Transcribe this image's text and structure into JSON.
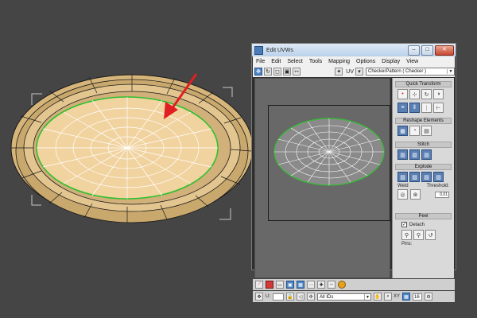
{
  "window": {
    "title": "Edit UVWs",
    "controls": {
      "minimize": "–",
      "maximize": "□",
      "close": "✕"
    }
  },
  "menu": [
    "File",
    "Edit",
    "Select",
    "Tools",
    "Mapping",
    "Options",
    "Display",
    "View"
  ],
  "toolbar": {
    "uv_label": "UV",
    "texture_dropdown": "CheckerPattern  ( Checker )"
  },
  "rollouts": {
    "quick_transform": "Quick Transform",
    "reshape_elements": "Reshape Elements",
    "stitch": "Stitch",
    "explode": "Explode",
    "weld_label": "Weld",
    "threshold_label": "Threshold:",
    "threshold_value": "0.01",
    "peel": "Peel",
    "detach_label": "Detach",
    "pins_label": "Pins:"
  },
  "bottom_toolbar": {
    "u_label": "U:",
    "xy_label": "XY",
    "zoom_value": "16",
    "element_filter": "All IDs"
  },
  "colors": {
    "plate_fill": "#e9c690",
    "edge_selection": "#2ec02e",
    "arrow": "#e02020",
    "uv_background": "#686868",
    "panel_background": "#d9d9d9"
  },
  "icons": {
    "arrow_annotation": "red-arrow-icon",
    "checkbox_checked": "checkbox-checked-icon"
  }
}
